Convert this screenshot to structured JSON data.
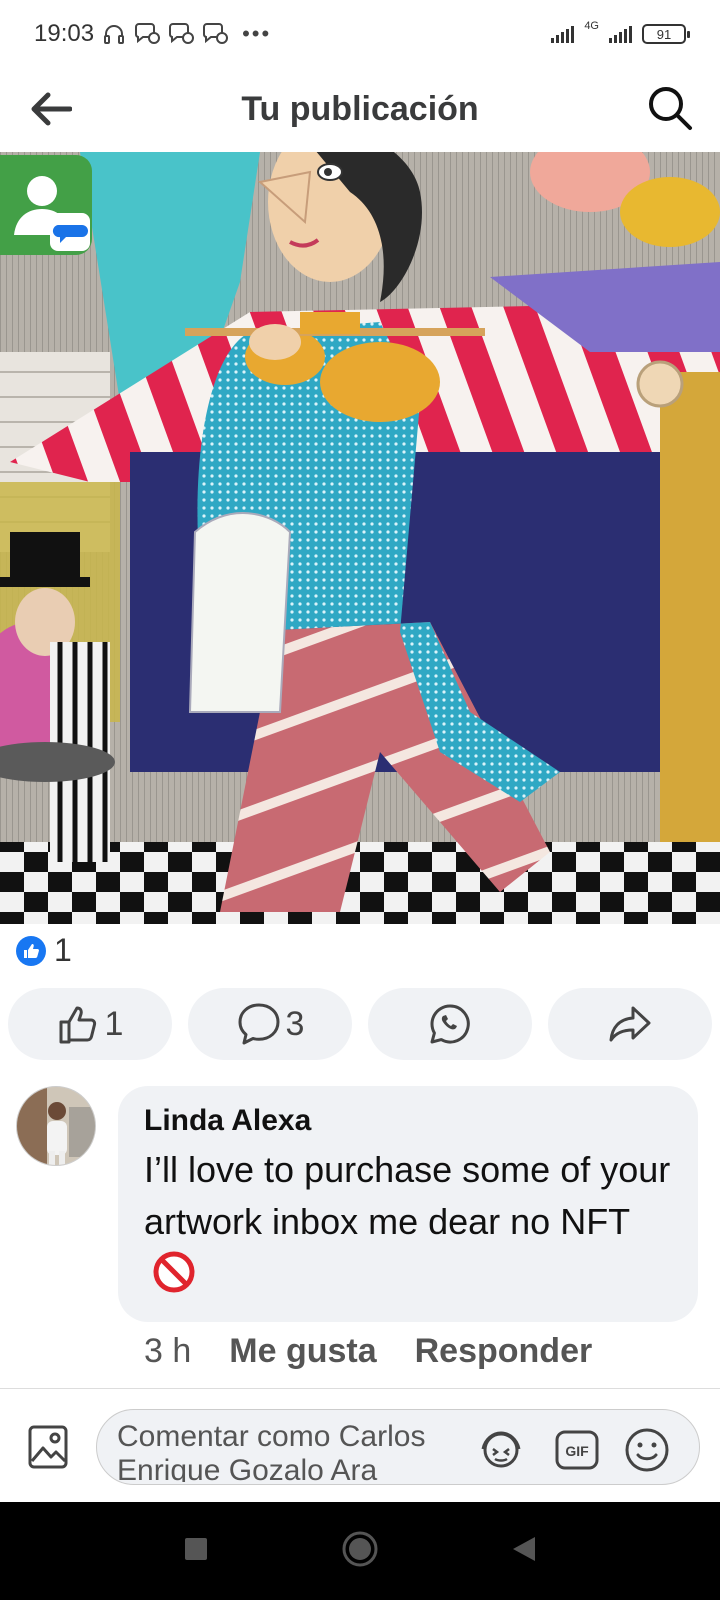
{
  "status_bar": {
    "time": "19:03",
    "network": "4G",
    "battery": "91"
  },
  "header": {
    "title": "Tu publicación",
    "back_icon": "arrow-left-icon",
    "search_icon": "search-icon"
  },
  "post": {
    "image_description_icon": "artwork-image",
    "reaction_count": "1",
    "actions": {
      "like_count": "1",
      "comment_count": "3",
      "whatsapp_icon": "whatsapp-icon",
      "share_icon": "share-icon"
    }
  },
  "comment": {
    "author": "Linda Alexa",
    "text": "I’ll love to purchase some of your artwork inbox me dear no NFT",
    "time": "3 h",
    "like_label": "Me gusta",
    "reply_label": "Responder"
  },
  "composer": {
    "placeholder_line1": "Comentar como Carlos",
    "placeholder_line2": "Enrique Gozalo Ara"
  },
  "colors": {
    "facebook_blue": "#1877f2",
    "pill_bg": "#f0f2f5",
    "chathead_green": "#43a047"
  }
}
